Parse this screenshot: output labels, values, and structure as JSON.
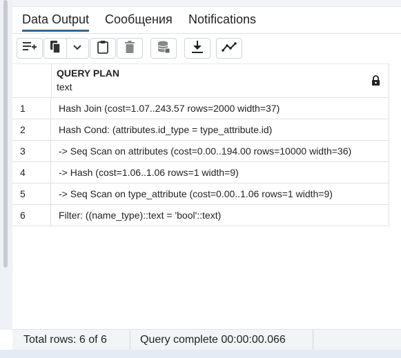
{
  "tabs": [
    {
      "label": "Data Output",
      "active": true
    },
    {
      "label": "Сообщения",
      "active": false
    },
    {
      "label": "Notifications",
      "active": false
    }
  ],
  "toolbar": {
    "buttons": [
      {
        "icon": "add-row-icon"
      },
      {
        "icon": "copy-icon"
      },
      {
        "icon": "chevron-down-icon"
      },
      {
        "icon": "paste-icon"
      },
      {
        "icon": "delete-icon"
      },
      {
        "icon": "save-data-icon"
      },
      {
        "icon": "download-icon"
      },
      {
        "icon": "graph-visualiser-icon"
      }
    ]
  },
  "grid": {
    "column": {
      "name": "QUERY PLAN",
      "type": "text",
      "icon": "lock-icon"
    },
    "rows": [
      {
        "num": "1",
        "value": "Hash Join (cost=1.07..243.57 rows=2000 width=37)"
      },
      {
        "num": "2",
        "value": "Hash Cond: (attributes.id_type = type_attribute.id)"
      },
      {
        "num": "3",
        "value": "-> Seq Scan on attributes (cost=0.00..194.00 rows=10000 width=36)"
      },
      {
        "num": "4",
        "value": "-> Hash (cost=1.06..1.06 rows=1 width=9)"
      },
      {
        "num": "5",
        "value": "-> Seq Scan on type_attribute (cost=0.00..1.06 rows=1 width=9)"
      },
      {
        "num": "6",
        "value": "Filter: ((name_type)::text = 'bool'::text)"
      }
    ]
  },
  "status": {
    "total_rows": "Total rows: 6 of 6",
    "query": "Query complete 00:00:00.066"
  },
  "colors": {
    "accent": "#326690",
    "border": "#dde1e6",
    "status_bg": "#f2f4f7"
  }
}
